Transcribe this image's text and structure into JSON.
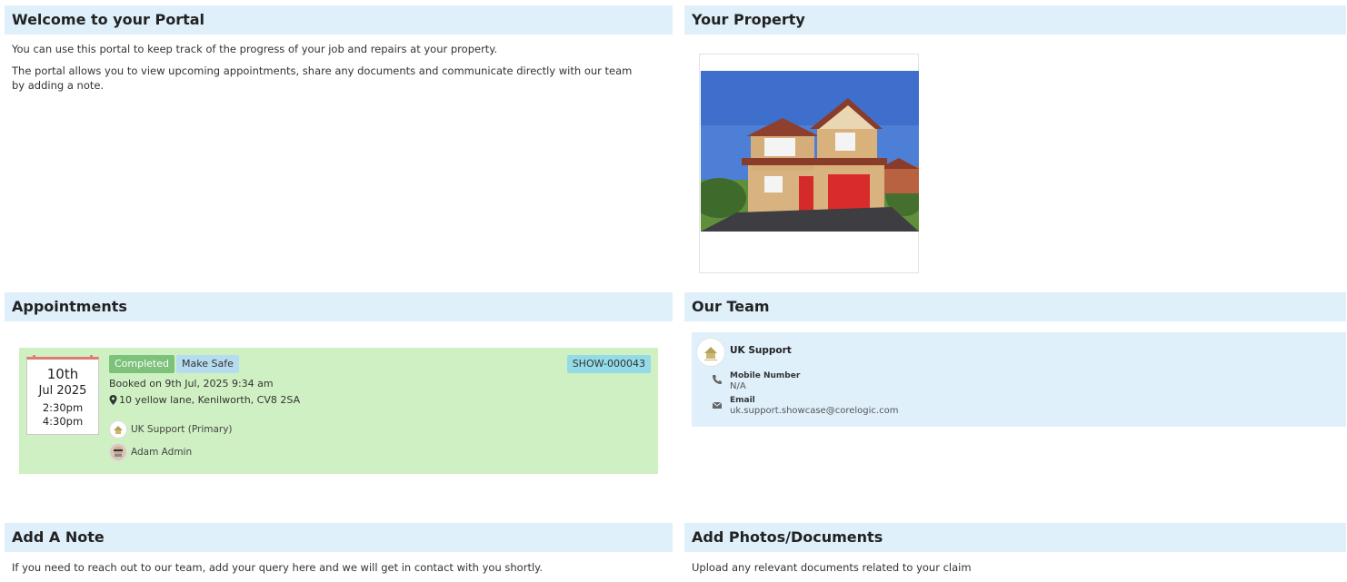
{
  "welcome": {
    "title": "Welcome to your Portal",
    "p1": "You can use this portal to keep track of the progress of your job and repairs at your property.",
    "p2": "The portal allows you to view upcoming appointments, share any documents and communicate directly with our team by adding a note."
  },
  "property": {
    "title": "Your Property",
    "image_icon": "house-photo"
  },
  "appointments": {
    "title": "Appointments",
    "items": [
      {
        "day": "10th",
        "month": "Jul 2025",
        "time_start": "2:30pm",
        "time_end": "4:30pm",
        "status": "Completed",
        "type": "Make Safe",
        "ref": "SHOW-000043",
        "booked": "Booked on 9th Jul, 2025 9:34 am",
        "address": "10 yellow lane, Kenilworth, CV8 2SA",
        "attendees": [
          "UK Support (Primary)",
          "Adam Admin"
        ]
      }
    ],
    "colors": {
      "card": "#cff0c2",
      "completed": "#7cc27a",
      "type": "#b6dcf0",
      "ref": "#93dbe6"
    }
  },
  "team": {
    "title": "Our Team",
    "members": [
      {
        "name": "UK Support",
        "mobile_label": "Mobile Number",
        "mobile_value": "N/A",
        "email_label": "Email",
        "email_value": "uk.support.showcase@corelogic.com"
      }
    ]
  },
  "note": {
    "title": "Add A Note",
    "text": "If you need to reach out to our team, add your query here and we will get in contact with you shortly."
  },
  "uploads": {
    "title": "Add Photos/Documents",
    "text": "Upload any relevant documents related to your claim"
  },
  "colors": {
    "header_bg": "#dff0fb",
    "team_card": "#dff0fb"
  }
}
